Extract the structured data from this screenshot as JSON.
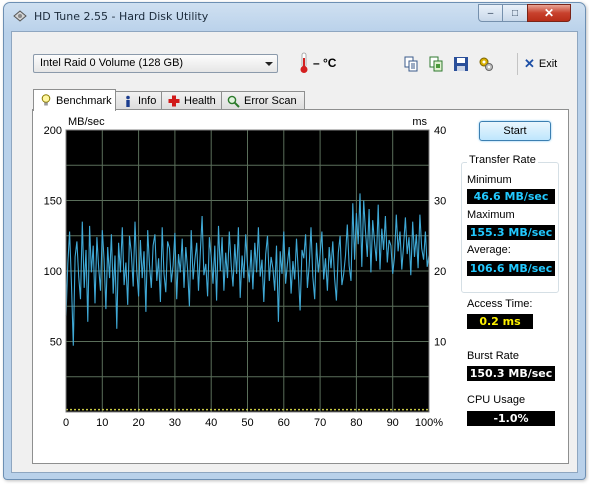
{
  "window": {
    "title": "HD Tune 2.55 - Hard Disk Utility",
    "controls": {
      "minimize": "–",
      "maximize": "□",
      "close": "✕"
    }
  },
  "toolbar": {
    "drive": "Intel   Raid 0 Volume (128 GB)",
    "temperature": "– °C",
    "exit_label": "Exit",
    "buttons": [
      "copy-text-icon",
      "copy-screenshot-icon",
      "save-icon",
      "options-icon"
    ]
  },
  "tabs": [
    {
      "label": "Benchmark",
      "icon": "lightbulb-icon",
      "active": true
    },
    {
      "label": "Info",
      "icon": "info-icon",
      "active": false
    },
    {
      "label": "Health",
      "icon": "health-cross-icon",
      "active": false
    },
    {
      "label": "Error Scan",
      "icon": "magnifier-icon",
      "active": false
    }
  ],
  "benchmark": {
    "start_label": "Start",
    "transfer_rate_title": "Transfer Rate",
    "minimum_label": "Minimum",
    "minimum_value": "46.6 MB/sec",
    "maximum_label": "Maximum",
    "maximum_value": "155.3 MB/sec",
    "average_label": "Average:",
    "average_value": "106.6 MB/sec",
    "access_time_label": "Access Time:",
    "access_time_value": "0.2 ms",
    "burst_rate_label": "Burst Rate",
    "burst_rate_value": "150.3 MB/sec",
    "cpu_usage_label": "CPU Usage",
    "cpu_usage_value": "-1.0%"
  },
  "chart_data": {
    "type": "line",
    "ylabel_left": "MB/sec",
    "ylabel_right": "ms",
    "xlim": [
      0,
      100
    ],
    "ylim_left": [
      0,
      200
    ],
    "ylim_right": [
      0,
      40
    ],
    "x_ticks": [
      "0",
      "10",
      "20",
      "30",
      "40",
      "50",
      "60",
      "70",
      "80",
      "90",
      "100%"
    ],
    "y_ticks_left": [
      "200",
      "150",
      "100",
      "50"
    ],
    "y_ticks_right": [
      "40",
      "30",
      "20",
      "10"
    ],
    "grid": true,
    "background": "#000000",
    "grid_color": "#5a6e5a",
    "series": [
      {
        "color": "#3fa9d6",
        "x": [
          0,
          0.5,
          1,
          1.5,
          2,
          2.5,
          3,
          3.5,
          4,
          4.5,
          5,
          5.5,
          6,
          6.5,
          7,
          7.5,
          8,
          8.5,
          9,
          9.5,
          10,
          10.5,
          11,
          11.5,
          12,
          12.5,
          13,
          13.5,
          14,
          14.5,
          15,
          15.5,
          16,
          16.5,
          17,
          17.5,
          18,
          18.5,
          19,
          19.5,
          20,
          20.5,
          21,
          21.5,
          22,
          22.5,
          23,
          23.5,
          24,
          24.5,
          25,
          25.5,
          26,
          26.5,
          27,
          27.5,
          28,
          28.5,
          29,
          29.5,
          30,
          30.5,
          31,
          31.5,
          32,
          32.5,
          33,
          33.5,
          34,
          34.5,
          35,
          35.5,
          36,
          36.5,
          37,
          37.5,
          38,
          38.5,
          39,
          39.5,
          40,
          40.5,
          41,
          41.5,
          42,
          42.5,
          43,
          43.5,
          44,
          44.5,
          45,
          45.5,
          46,
          46.5,
          47,
          47.5,
          48,
          48.5,
          49,
          49.5,
          50,
          50.5,
          51,
          51.5,
          52,
          52.5,
          53,
          53.5,
          54,
          54.5,
          55,
          55.5,
          56,
          56.5,
          57,
          57.5,
          58,
          58.5,
          59,
          59.5,
          60,
          60.5,
          61,
          61.5,
          62,
          62.5,
          63,
          63.5,
          64,
          64.5,
          65,
          65.5,
          66,
          66.5,
          67,
          67.5,
          68,
          68.5,
          69,
          69.5,
          70,
          70.5,
          71,
          71.5,
          72,
          72.5,
          73,
          73.5,
          74,
          74.5,
          75,
          75.5,
          76,
          76.5,
          77,
          77.5,
          78,
          78.5,
          79,
          79.5,
          80,
          80.5,
          81,
          81.5,
          82,
          82.5,
          83,
          83.5,
          84,
          84.5,
          85,
          85.5,
          86,
          86.5,
          87,
          87.5,
          88,
          88.5,
          89,
          89.5,
          90,
          90.5,
          91,
          91.5,
          92,
          92.5,
          93,
          93.5,
          94,
          94.5,
          95,
          95.5,
          96,
          96.5,
          97,
          97.5,
          98,
          98.5,
          99,
          99.5,
          100
        ],
        "y": [
          68,
          105,
          128,
          92,
          47,
          110,
          121,
          96,
          80,
          135,
          88,
          115,
          64,
          132,
          99,
          118,
          77,
          124,
          102,
          86,
          129,
          108,
          73,
          117,
          95,
          126,
          84,
          111,
          59,
          120,
          99,
          131,
          90,
          106,
          76,
          125,
          113,
          89,
          135,
          100,
          82,
          122,
          95,
          114,
          71,
          129,
          104,
          88,
          118,
          126,
          93,
          109,
          78,
          131,
          98,
          85,
          121,
          116,
          92,
          104,
          127,
          80,
          112,
          99,
          123,
          88,
          117,
          101,
          75,
          129,
          94,
          108,
          120,
          86,
          113,
          139,
          97,
          105,
          82,
          124,
          110,
          91,
          118,
          79,
          132,
          100,
          124,
          86,
          113,
          95,
          128,
          104,
          89,
          119,
          98,
          131,
          81,
          111,
          95,
          126,
          104,
          92,
          115,
          87,
          120,
          99,
          131,
          96,
          108,
          78,
          112,
          125,
          93,
          110,
          102,
          86,
          118,
          64,
          114,
          98,
          128,
          91,
          105,
          117,
          84,
          107,
          94,
          123,
          99,
          72,
          115,
          109,
          126,
          88,
          104,
          131,
          96,
          80,
          120,
          99,
          112,
          128,
          94,
          109,
          86,
          117,
          102,
          121,
          95,
          79,
          113,
          125,
          90,
          98,
          111,
          133,
          104,
          93,
          148,
          108,
          141,
          119,
          155,
          103,
          150,
          128,
          110,
          144,
          99,
          136,
          120,
          107,
          147,
          101,
          130,
          115,
          139,
          106,
          122,
          118,
          98,
          110,
          140,
          114,
          128,
          101,
          118,
          138,
          112,
          124,
          97,
          135,
          110,
          126,
          102,
          140,
          116,
          108,
          128,
          103,
          111
        ]
      },
      {
        "color": "#c8c844",
        "x": [
          0,
          10,
          20,
          30,
          40,
          50,
          60,
          70,
          80,
          90,
          100
        ],
        "y_ms": [
          0.2,
          0.2,
          0.2,
          0.2,
          0.2,
          0.2,
          0.2,
          0.2,
          0.2,
          0.2,
          0.2
        ]
      }
    ]
  }
}
